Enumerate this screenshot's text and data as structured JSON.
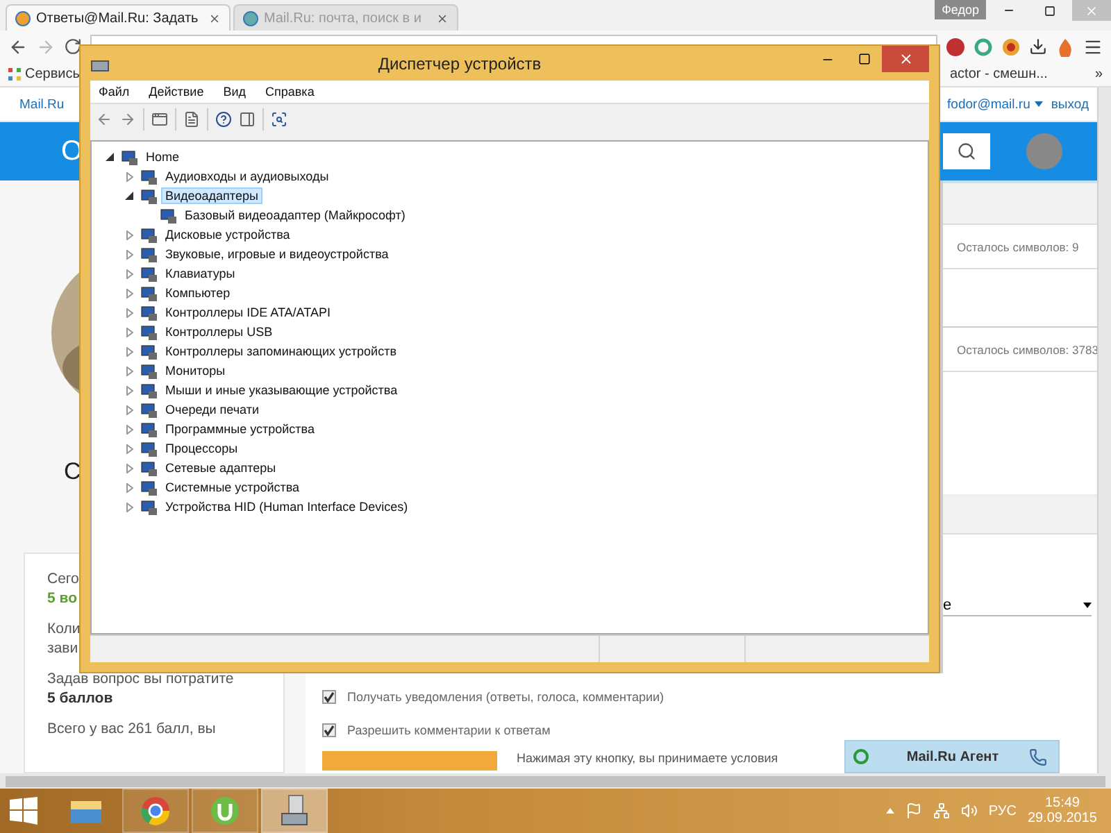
{
  "browser": {
    "tabs": [
      {
        "title": "Ответы@Mail.Ru: Задать",
        "selected": true
      },
      {
        "title": "Mail.Ru: почта, поиск в и",
        "selected": false
      }
    ],
    "user": "Федор",
    "bookmarks": [
      {
        "label": "Сервисы"
      },
      {
        "label": "actor - смешн..."
      }
    ],
    "bookmarks_more": "»",
    "portal_bar": {
      "logo": "Mail.Ru",
      "account": "fodor@mail.ru",
      "logout": "выход"
    },
    "header": {
      "title_fragment": "О"
    },
    "sidebar": {
      "fragment": "С",
      "paragraphs": [
        {
          "lines": [
            {
              "text": "Сего",
              "kind": "plain"
            },
            {
              "text": "5 во",
              "kind": "accent"
            }
          ]
        },
        {
          "lines": [
            {
              "text": "Коли",
              "kind": "plain"
            },
            {
              "text": "зави",
              "kind": "plain"
            }
          ]
        },
        {
          "lines": [
            {
              "text": "Задав вопрос вы потратите",
              "kind": "plain"
            },
            {
              "text": "5 баллов",
              "kind": "strong"
            }
          ]
        },
        {
          "lines": [
            {
              "text": "Всего у вас 261 балл, вы",
              "kind": "plain"
            }
          ]
        }
      ]
    },
    "form": {
      "counters": [
        "Осталось символов: 9",
        "Осталось символов: 3783"
      ],
      "select_value": "e",
      "options": [
        {
          "label": "Получать уведомления (ответы, голоса, комментарии)",
          "checked": true
        },
        {
          "label": "Разрешить комментарии к ответам",
          "checked": true
        }
      ],
      "submit_note": "Нажимая эту кнопку, вы принимаете условия"
    },
    "agent": {
      "label": "Mail.Ru Агент"
    }
  },
  "device_manager": {
    "title": "Диспетчер устройств",
    "menu": [
      "Файл",
      "Действие",
      "Вид",
      "Справка"
    ],
    "tree": [
      {
        "label": "Home",
        "expanded": true,
        "selected": false,
        "children": [
          {
            "label": "Аудиовходы и аудиовыходы",
            "expanded": false,
            "selected": false
          },
          {
            "label": "Видеоадаптеры",
            "expanded": true,
            "selected": true,
            "children": [
              {
                "label": "Базовый видеоадаптер (Майкрософт)",
                "selected": false
              }
            ]
          },
          {
            "label": "Дисковые устройства",
            "expanded": false,
            "selected": false
          },
          {
            "label": "Звуковые, игровые и видеоустройства",
            "expanded": false,
            "selected": false
          },
          {
            "label": "Клавиатуры",
            "expanded": false,
            "selected": false
          },
          {
            "label": "Компьютер",
            "expanded": false,
            "selected": false
          },
          {
            "label": "Контроллеры IDE ATA/ATAPI",
            "expanded": false,
            "selected": false
          },
          {
            "label": "Контроллеры USB",
            "expanded": false,
            "selected": false
          },
          {
            "label": "Контроллеры запоминающих устройств",
            "expanded": false,
            "selected": false
          },
          {
            "label": "Мониторы",
            "expanded": false,
            "selected": false
          },
          {
            "label": "Мыши и иные указывающие устройства",
            "expanded": false,
            "selected": false
          },
          {
            "label": "Очереди печати",
            "expanded": false,
            "selected": false
          },
          {
            "label": "Программные устройства",
            "expanded": false,
            "selected": false
          },
          {
            "label": "Процессоры",
            "expanded": false,
            "selected": false
          },
          {
            "label": "Сетевые адаптеры",
            "expanded": false,
            "selected": false
          },
          {
            "label": "Системные устройства",
            "expanded": false,
            "selected": false
          },
          {
            "label": "Устройства HID (Human Interface Devices)",
            "expanded": false,
            "selected": false
          }
        ]
      }
    ]
  },
  "taskbar": {
    "apps": [
      {
        "kind": "explorer",
        "running": false,
        "selected": false
      },
      {
        "kind": "browser",
        "running": true,
        "selected": false
      },
      {
        "kind": "torrent",
        "running": true,
        "selected": false
      },
      {
        "kind": "devices",
        "running": true,
        "selected": true
      }
    ],
    "language": "РУС",
    "time": "15:49",
    "date": "29.09.2015"
  }
}
